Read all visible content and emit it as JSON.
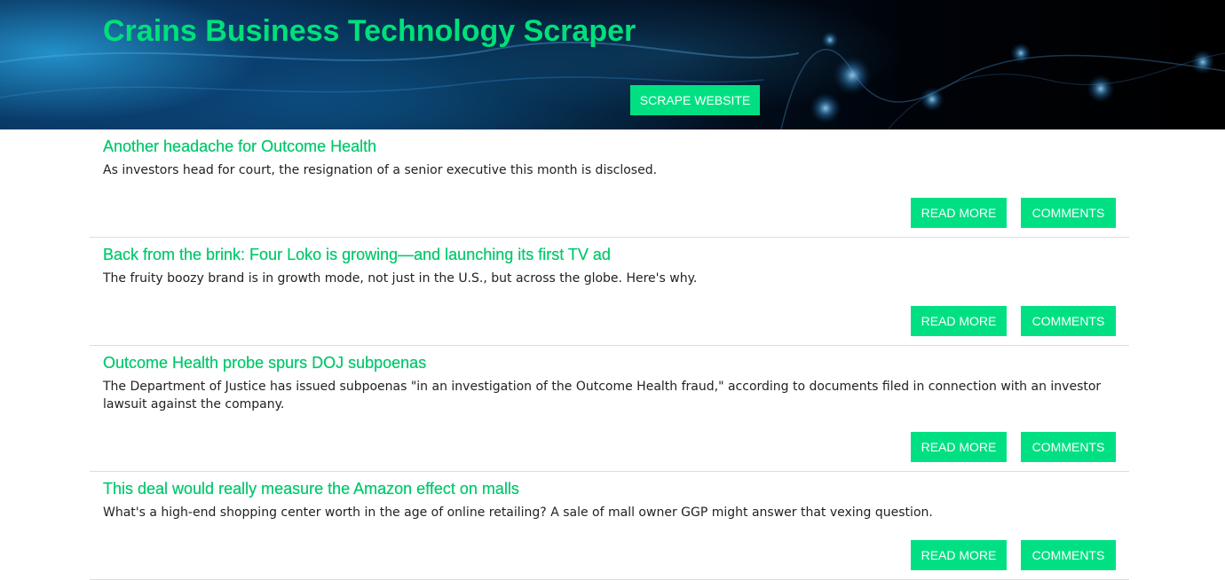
{
  "header": {
    "title": "Crains Business Technology Scraper",
    "scrape_button": "SCRAPE WEBSITE",
    "accent": "#00e083"
  },
  "articles": [
    {
      "title": "Another headache for Outcome Health",
      "summary": "As investors head for court, the resignation of a senior executive this month is disclosed.",
      "read_more": "READ MORE",
      "comments": "COMMENTS"
    },
    {
      "title": "Back from the brink: Four Loko is growing—and launching its first TV ad",
      "summary": "The fruity boozy brand is in growth mode, not just in the U.S., but across the globe. Here's why.",
      "read_more": "READ MORE",
      "comments": "COMMENTS"
    },
    {
      "title": "Outcome Health probe spurs DOJ subpoenas",
      "summary": "The Department of Justice has issued subpoenas \"in an investigation of the Outcome Health fraud,\" according to documents filed in connection with an investor lawsuit against the company.",
      "read_more": "READ MORE",
      "comments": "COMMENTS"
    },
    {
      "title": "This deal would really measure the Amazon effect on malls",
      "summary": "What's a high-end shopping center worth in the age of online retailing? A sale of mall owner GGP might answer that vexing question.",
      "read_more": "READ MORE",
      "comments": "COMMENTS"
    }
  ]
}
